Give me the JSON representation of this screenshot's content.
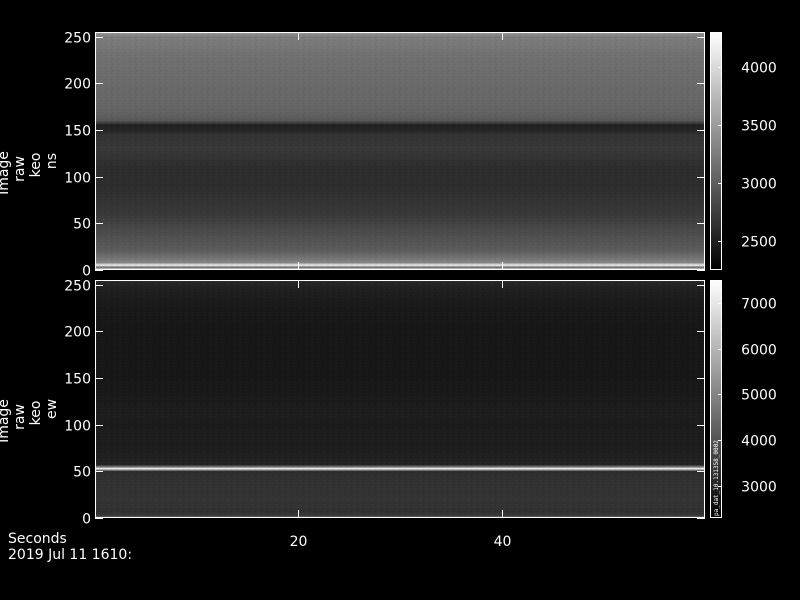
{
  "footer": {
    "seconds_label": "Seconds",
    "date_label": "2019 Jul 11 1610:"
  },
  "chart_data": [
    {
      "type": "heatmap",
      "ylabel_lines": [
        "Image",
        "raw",
        "keo",
        "ns"
      ],
      "x_ticks": [
        20,
        40
      ],
      "y_ticks": [
        0,
        50,
        100,
        150,
        200,
        250
      ],
      "xlim": [
        0,
        60
      ],
      "ylim": [
        0,
        255
      ],
      "colorbar": {
        "ticks": [
          2500,
          3000,
          3500,
          4000
        ],
        "range": [
          2250,
          4300
        ],
        "colormap": "gray"
      },
      "profile": [
        {
          "y": 0,
          "v": 4300
        },
        {
          "y": 3,
          "v": 3050
        },
        {
          "y": 5,
          "v": 4200
        },
        {
          "y": 8,
          "v": 3300
        },
        {
          "y": 20,
          "v": 3000
        },
        {
          "y": 40,
          "v": 2850
        },
        {
          "y": 60,
          "v": 2700
        },
        {
          "y": 90,
          "v": 2600
        },
        {
          "y": 110,
          "v": 2600
        },
        {
          "y": 130,
          "v": 2700
        },
        {
          "y": 145,
          "v": 2650
        },
        {
          "y": 150,
          "v": 2550
        },
        {
          "y": 155,
          "v": 2500
        },
        {
          "y": 160,
          "v": 2950
        },
        {
          "y": 170,
          "v": 3050
        },
        {
          "y": 200,
          "v": 3100
        },
        {
          "y": 230,
          "v": 3150
        },
        {
          "y": 250,
          "v": 3250
        },
        {
          "y": 255,
          "v": 3500
        }
      ]
    },
    {
      "type": "heatmap",
      "ylabel_lines": [
        "Image",
        "raw",
        "keo",
        "ew"
      ],
      "x_ticks": [
        20,
        40
      ],
      "y_ticks": [
        0,
        50,
        100,
        150,
        200,
        250
      ],
      "xlim": [
        0,
        60
      ],
      "ylim": [
        0,
        255
      ],
      "colorbar": {
        "ticks": [
          3000,
          4000,
          5000,
          6000,
          7000
        ],
        "range": [
          2300,
          7500
        ],
        "colormap": "gray",
        "side_label": "pa_dat_10.131358_0002"
      },
      "profile": [
        {
          "y": 0,
          "v": 4600
        },
        {
          "y": 3,
          "v": 3400
        },
        {
          "y": 8,
          "v": 3300
        },
        {
          "y": 20,
          "v": 3350
        },
        {
          "y": 40,
          "v": 3300
        },
        {
          "y": 50,
          "v": 3200
        },
        {
          "y": 52,
          "v": 6000
        },
        {
          "y": 53,
          "v": 7500
        },
        {
          "y": 54,
          "v": 5500
        },
        {
          "y": 57,
          "v": 3000
        },
        {
          "y": 70,
          "v": 2900
        },
        {
          "y": 100,
          "v": 2850
        },
        {
          "y": 110,
          "v": 2900
        },
        {
          "y": 120,
          "v": 2850
        },
        {
          "y": 150,
          "v": 2750
        },
        {
          "y": 200,
          "v": 2750
        },
        {
          "y": 230,
          "v": 2800
        },
        {
          "y": 250,
          "v": 3000
        },
        {
          "y": 255,
          "v": 3150
        }
      ]
    }
  ]
}
